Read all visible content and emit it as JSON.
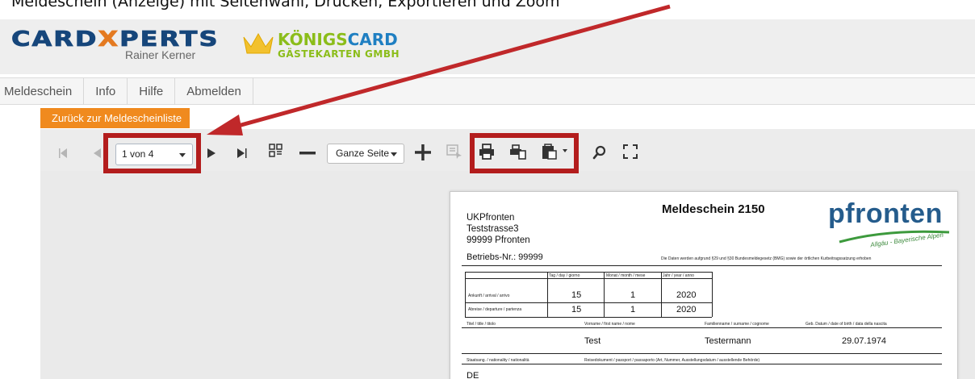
{
  "caption": "Meldeschein (Anzeige) mit Seitenwahl, Drucken, Exportieren und Zoom",
  "header": {
    "logo_part1": "CARD",
    "logo_x": "X",
    "logo_part2": "PERTS",
    "logo_sub": "Rainer Kerner",
    "brand2_a": "KÖNIGS",
    "brand2_b": "CARD",
    "brand2_line2": "GÄSTEKARTEN GMBH"
  },
  "menu": [
    "Meldeschein",
    "Info",
    "Hilfe",
    "Abmelden"
  ],
  "back_button": "Zurück zur Meldescheinliste",
  "toolbar": {
    "page_select_value": "1 von 4",
    "zoom_select_value": "Ganze Seite",
    "icons": [
      "first-page-icon",
      "prev-page-icon",
      "next-page-icon",
      "last-page-icon",
      "multi-page-icon",
      "zoom-out-icon",
      "zoom-in-icon",
      "select-tool-icon",
      "print-icon",
      "print-page-icon",
      "export-icon",
      "search-icon",
      "fullscreen-icon"
    ]
  },
  "colors": {
    "accent": "#f08a1e",
    "highlight": "#b31d1d",
    "arrow": "#c0282a",
    "brand_blue": "#16467b"
  },
  "document": {
    "title": "Meldeschein 2150",
    "address": [
      "UKPfronten",
      "Teststrasse3",
      "99999  Pfronten"
    ],
    "betrieb": "Betriebs-Nr.: 99999",
    "logo": "pfronten",
    "logo_tagline": "Allgäu - Bayerische Alpen",
    "legal_note": "Die Daten werden aufgrund §29 und §30 Bundesmeldegesetz (BMG) sowie der örtlichen Kurbeitragssatzung erhoben",
    "table_headers": [
      "Tag / day / giorno",
      "Monat / month / mese",
      "Jahr / year / anno"
    ],
    "arrival_label": "Ankunft / arrival / arrivo",
    "departure_label": "Abreise / departure / partenza",
    "arrival": [
      "15",
      "1",
      "2020"
    ],
    "departure": [
      "15",
      "1",
      "2020"
    ],
    "person_headers": [
      "Titel / title / titolo",
      "Vorname / first name / nome",
      "Familienname / surname / cognome",
      "Geb. Datum / date of birth / data della nascita"
    ],
    "first_name": "Test",
    "surname": "Testermann",
    "birth_date": "29.07.1974",
    "nationality_label": "Staatsang. / nationality / nationalità",
    "passport_label": "Reisedokument / passport / passaporto (Art, Nummer, Ausstellungsdatum / ausstellende Behörde)",
    "nationality": "DE"
  }
}
